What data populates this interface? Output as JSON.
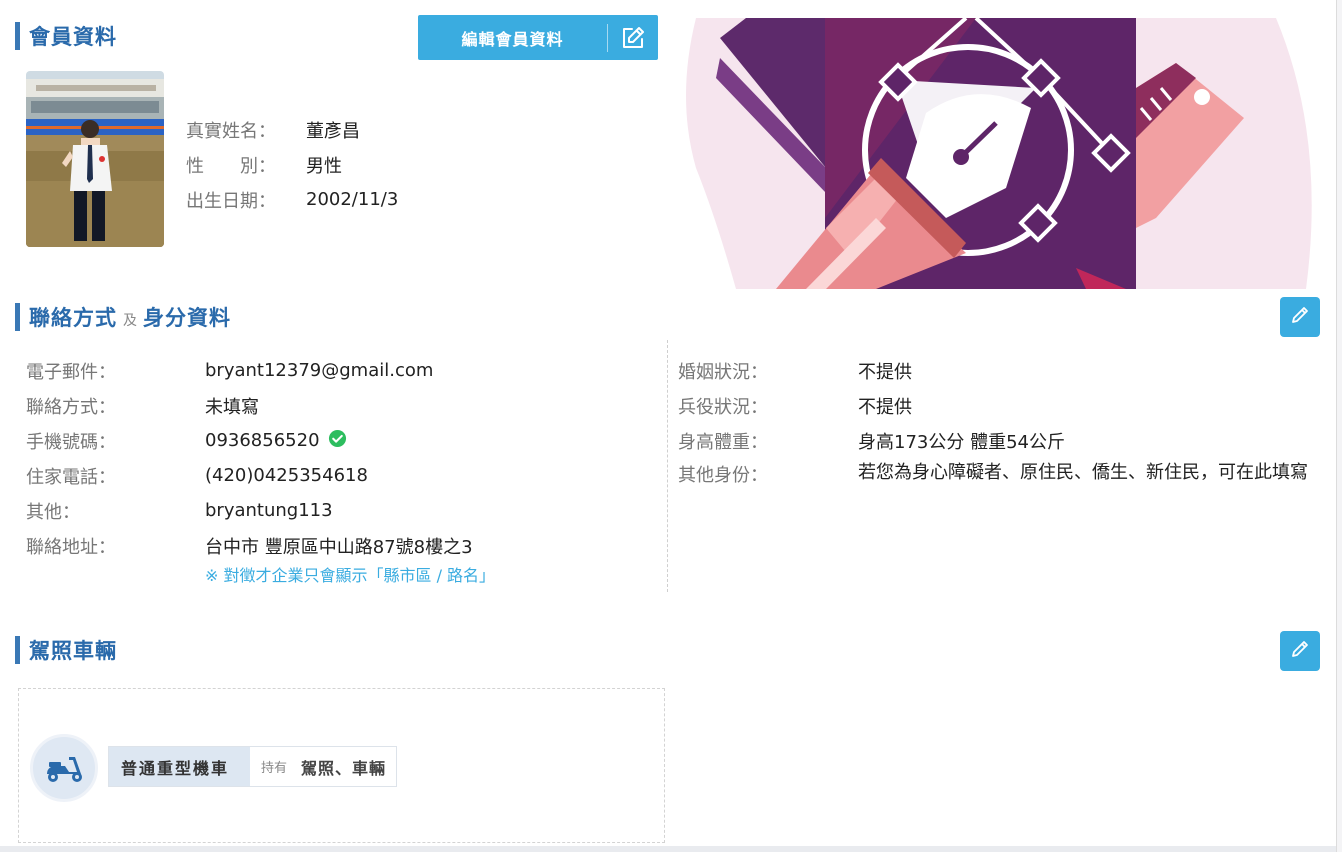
{
  "member": {
    "section_title": "會員資料",
    "edit_button_label": "編輯會員資料",
    "fields": [
      {
        "key": "真實姓名：",
        "value": "董彥昌"
      },
      {
        "key": "性　　別：",
        "value": "男性"
      },
      {
        "key": "出生日期：",
        "value": "2002/11/3"
      }
    ]
  },
  "contact": {
    "title_main": "聯絡方式",
    "title_and": "及",
    "title_second": "身分資料",
    "left_fields": [
      {
        "key": "電子郵件：",
        "value": "bryant12379@gmail.com"
      },
      {
        "key": "聯絡方式：",
        "value": "未填寫"
      },
      {
        "key": "手機號碼：",
        "value": "0936856520"
      },
      {
        "key": "住家電話：",
        "value": "(420)0425354618"
      },
      {
        "key": "其他：",
        "value": "bryantung113"
      },
      {
        "key": "聯絡地址：",
        "value": "台中市 豐原區中山路87號8樓之3"
      }
    ],
    "address_note": "※ 對徵才企業只會顯示「縣市區 / 路名」",
    "right_fields": [
      {
        "key": "婚姻狀況：",
        "value": "不提供"
      },
      {
        "key": "兵役狀況：",
        "value": "不提供"
      },
      {
        "key": "身高體重：",
        "value": "身高173公分 體重54公斤"
      },
      {
        "key": "其他身份：",
        "value": "若您為身心障礙者、原住民、僑生、新住民，可在此填寫"
      }
    ]
  },
  "vehicle": {
    "section_title": "駕照車輛",
    "license_name": "普通重型機車",
    "have_label": "持有",
    "have_items": "駕照、車輛"
  },
  "icons": {
    "edit": "pencil-square-icon",
    "pencil": "pencil-icon",
    "verified": "check-circle-icon",
    "vehicle": "scooter-icon"
  },
  "colors": {
    "accent": "#3aace0",
    "title": "#2a6aab",
    "verified": "#2dbd5f",
    "note": "#3aace0"
  }
}
